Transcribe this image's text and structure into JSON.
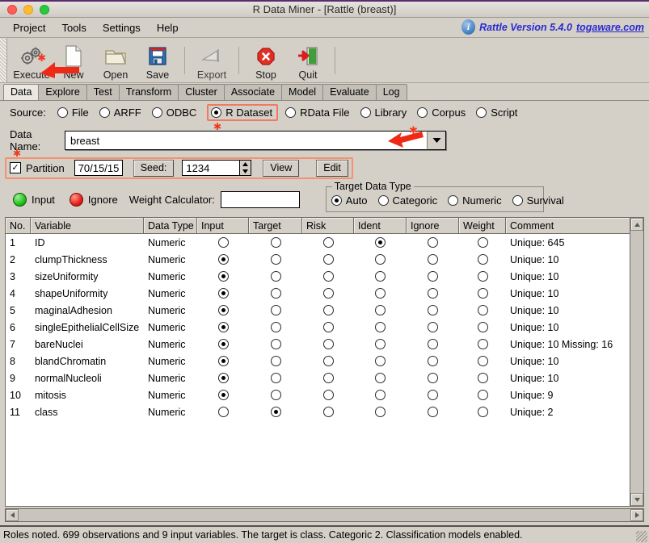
{
  "window": {
    "title": "R Data Miner - [Rattle (breast)]"
  },
  "menubar": {
    "items": [
      "Project",
      "Tools",
      "Settings",
      "Help"
    ],
    "version_text": "Rattle Version 5.4.0",
    "version_link": "togaware.com",
    "info_icon": "info-icon",
    "info_glyph": "i"
  },
  "toolbar": {
    "items": [
      {
        "label": "Execute",
        "icon": "gears-icon",
        "marked": true
      },
      {
        "label": "New",
        "icon": "page-icon",
        "marked": false
      },
      {
        "label": "Open",
        "icon": "folder-icon",
        "marked": false
      },
      {
        "label": "Save",
        "icon": "floppy-icon",
        "marked": false
      },
      {
        "label": "Export",
        "icon": "export-icon",
        "marked": false
      },
      {
        "label": "Stop",
        "icon": "stop-icon",
        "marked": false
      },
      {
        "label": "Quit",
        "icon": "quit-door-icon",
        "marked": false
      }
    ]
  },
  "tabs": [
    {
      "label": "Data",
      "active": true
    },
    {
      "label": "Explore",
      "active": false
    },
    {
      "label": "Test",
      "active": false
    },
    {
      "label": "Transform",
      "active": false
    },
    {
      "label": "Cluster",
      "active": false
    },
    {
      "label": "Associate",
      "active": false
    },
    {
      "label": "Model",
      "active": false
    },
    {
      "label": "Evaluate",
      "active": false
    },
    {
      "label": "Log",
      "active": false
    }
  ],
  "source": {
    "label": "Source:",
    "options": [
      {
        "label": "File",
        "selected": false,
        "highlighted": false
      },
      {
        "label": "ARFF",
        "selected": false,
        "highlighted": false
      },
      {
        "label": "ODBC",
        "selected": false,
        "highlighted": false
      },
      {
        "label": "R Dataset",
        "selected": true,
        "highlighted": true
      },
      {
        "label": "RData File",
        "selected": false,
        "highlighted": false
      },
      {
        "label": "Library",
        "selected": false,
        "highlighted": false
      },
      {
        "label": "Corpus",
        "selected": false,
        "highlighted": false
      },
      {
        "label": "Script",
        "selected": false,
        "highlighted": false
      }
    ]
  },
  "data_name": {
    "label": "Data Name:",
    "value": "breast",
    "dropdown_icon": "chevron-down-icon"
  },
  "partition": {
    "checkbox_label": "Partition",
    "checked": true,
    "check_glyph": "✓",
    "ratio": "70/15/15",
    "seed_label": "Seed:",
    "seed_value": "1234",
    "view_button": "View",
    "edit_button": "Edit"
  },
  "roles": {
    "input_label": "Input",
    "ignore_label": "Ignore",
    "weight_label": "Weight Calculator:",
    "weight_value": ""
  },
  "target_data_type": {
    "title": "Target Data Type",
    "options": [
      {
        "label": "Auto",
        "selected": true
      },
      {
        "label": "Categoric",
        "selected": false
      },
      {
        "label": "Numeric",
        "selected": false
      },
      {
        "label": "Survival",
        "selected": false
      }
    ]
  },
  "table": {
    "columns": [
      "No.",
      "Variable",
      "Data Type",
      "Input",
      "Target",
      "Risk",
      "Ident",
      "Ignore",
      "Weight",
      "Comment"
    ],
    "rows": [
      {
        "no": "1",
        "variable": "ID",
        "datatype": "Numeric",
        "role": "Ident",
        "comment": "Unique: 645"
      },
      {
        "no": "2",
        "variable": "clumpThickness",
        "datatype": "Numeric",
        "role": "Input",
        "comment": "Unique: 10"
      },
      {
        "no": "3",
        "variable": "sizeUniformity",
        "datatype": "Numeric",
        "role": "Input",
        "comment": "Unique: 10"
      },
      {
        "no": "4",
        "variable": "shapeUniformity",
        "datatype": "Numeric",
        "role": "Input",
        "comment": "Unique: 10"
      },
      {
        "no": "5",
        "variable": "maginalAdhesion",
        "datatype": "Numeric",
        "role": "Input",
        "comment": "Unique: 10"
      },
      {
        "no": "6",
        "variable": "singleEpithelialCellSize",
        "datatype": "Numeric",
        "role": "Input",
        "comment": "Unique: 10"
      },
      {
        "no": "7",
        "variable": "bareNuclei",
        "datatype": "Numeric",
        "role": "Input",
        "comment": "Unique: 10 Missing: 16"
      },
      {
        "no": "8",
        "variable": "blandChromatin",
        "datatype": "Numeric",
        "role": "Input",
        "comment": "Unique: 10"
      },
      {
        "no": "9",
        "variable": "normalNucleoli",
        "datatype": "Numeric",
        "role": "Input",
        "comment": "Unique: 10"
      },
      {
        "no": "10",
        "variable": "mitosis",
        "datatype": "Numeric",
        "role": "Input",
        "comment": "Unique: 9"
      },
      {
        "no": "11",
        "variable": "class",
        "datatype": "Numeric",
        "role": "Target",
        "comment": "Unique: 2"
      }
    ],
    "role_columns": [
      "Input",
      "Target",
      "Risk",
      "Ident",
      "Ignore",
      "Weight"
    ]
  },
  "statusbar": {
    "text": "Roles noted. 699 observations and 9 input variables. The target is class. Categoric 2. Classification models enabled."
  },
  "annotations": {
    "accent_color": "#f03a1e",
    "highlight_border": "#f07a60",
    "asterisk_glyph": "✱"
  }
}
